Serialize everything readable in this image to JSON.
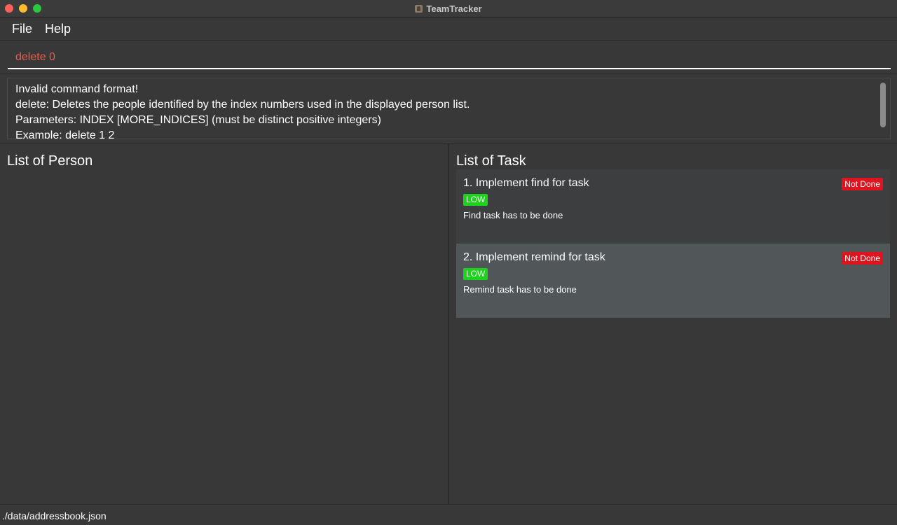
{
  "window": {
    "title": "TeamTracker"
  },
  "menu": {
    "items": [
      "File",
      "Help"
    ]
  },
  "command": {
    "value": "delete 0"
  },
  "result": {
    "lines": [
      "Invalid command format!",
      "delete: Deletes the people identified by the index numbers used in the displayed person list.",
      "Parameters: INDEX [MORE_INDICES] (must be distinct positive integers)",
      "Example: delete 1 2"
    ]
  },
  "person_pane": {
    "title": "List of Person"
  },
  "task_pane": {
    "title": "List of Task",
    "tasks": [
      {
        "name": "1. Implement find for task",
        "status": "Not Done",
        "priority": "LOW",
        "description": "Find task has to be done"
      },
      {
        "name": "2. Implement remind for task",
        "status": "Not Done",
        "priority": "LOW",
        "description": "Remind task has to be done"
      }
    ]
  },
  "statusbar": {
    "path": "./data/addressbook.json"
  },
  "colors": {
    "background": "#383838",
    "command_text": "#e2614c",
    "status_not_done": "#e0141e",
    "priority_low": "#1ad31a"
  }
}
